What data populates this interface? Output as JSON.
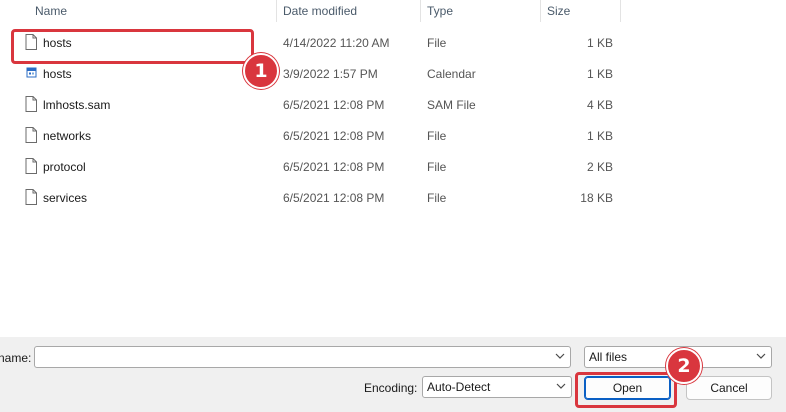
{
  "columns": {
    "name": "Name",
    "date_modified": "Date modified",
    "type": "Type",
    "size": "Size"
  },
  "files": [
    {
      "name": "hosts",
      "date": "4/14/2022 11:20 AM",
      "type": "File",
      "size": "1 KB",
      "icon": "file-icon"
    },
    {
      "name": "hosts",
      "date": "3/9/2022 1:57 PM",
      "type": "Calendar",
      "size": "1 KB",
      "icon": "calendar-file-icon"
    },
    {
      "name": "lmhosts.sam",
      "date": "6/5/2021 12:08 PM",
      "type": "SAM File",
      "size": "4 KB",
      "icon": "file-icon"
    },
    {
      "name": "networks",
      "date": "6/5/2021 12:08 PM",
      "type": "File",
      "size": "1 KB",
      "icon": "file-icon"
    },
    {
      "name": "protocol",
      "date": "6/5/2021 12:08 PM",
      "type": "File",
      "size": "2 KB",
      "icon": "file-icon"
    },
    {
      "name": "services",
      "date": "6/5/2021 12:08 PM",
      "type": "File",
      "size": "18 KB",
      "icon": "file-icon"
    }
  ],
  "bottom": {
    "filename_label": "name:",
    "filename_value": "",
    "filetype_value": "All files",
    "encoding_label": "Encoding:",
    "encoding_value": "Auto-Detect",
    "open_label": "Open",
    "cancel_label": "Cancel"
  },
  "annotations": {
    "step1": "1",
    "step2": "2",
    "color": "#d9363e"
  },
  "colors": {
    "panel_bg": "#f0f0f0",
    "primary_border": "#0a5fc4",
    "header_text": "#4a5a6a"
  }
}
